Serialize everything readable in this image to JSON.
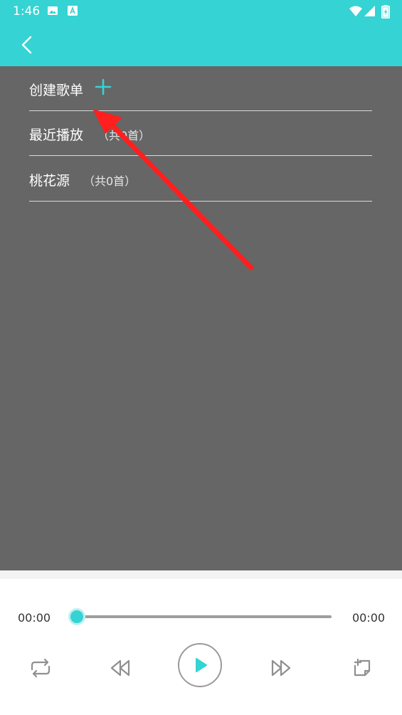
{
  "status_bar": {
    "time": "1:46"
  },
  "playlists": {
    "create": {
      "label": "创建歌单"
    },
    "items": [
      {
        "title": "最近播放",
        "count": "（共0首）"
      },
      {
        "title": "桃花源",
        "count": "（共0首）"
      }
    ]
  },
  "player": {
    "current_time": "00:00",
    "total_time": "00:00",
    "progress": 0
  },
  "colors": {
    "accent": "#35d3d3",
    "content_bg": "#666666",
    "annotation_arrow": "#ff1f1f"
  }
}
